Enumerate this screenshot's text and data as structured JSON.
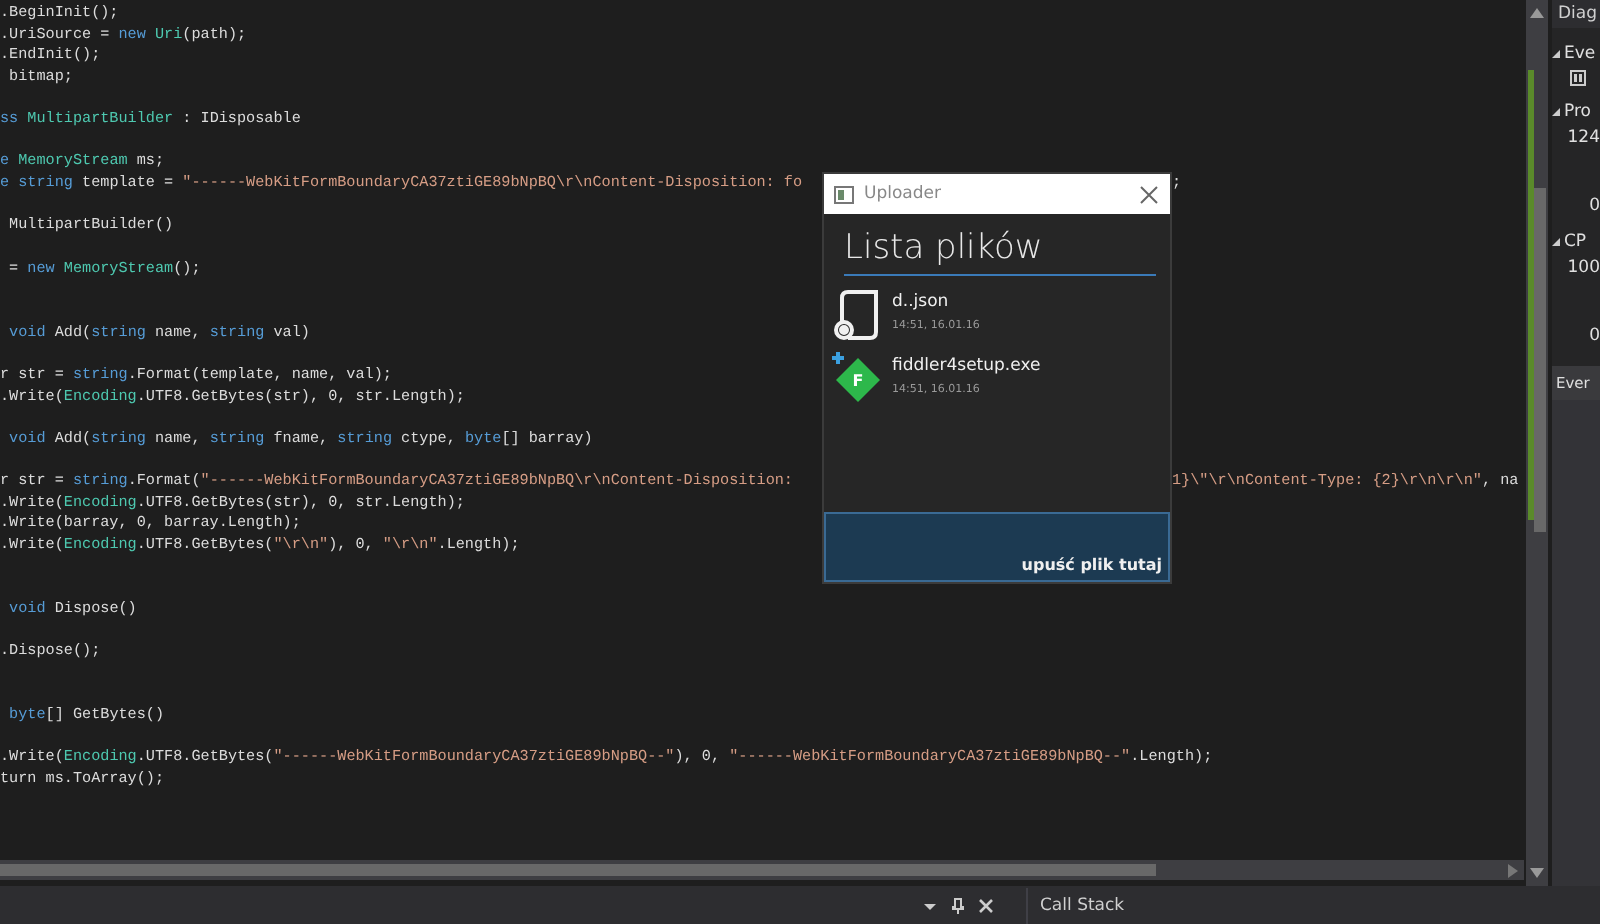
{
  "editor": {
    "lines": [
      {
        "kind": "line",
        "segments": [
          {
            "text": ".BeginInit();",
            "kind": "plain"
          }
        ]
      },
      {
        "kind": "line",
        "segments": [
          {
            "text": ".UriSource = ",
            "kind": "plain"
          },
          {
            "text": "new",
            "kind": "keyword"
          },
          {
            "text": " Uri",
            "kind": "type"
          },
          {
            "text": "(path);",
            "kind": "plain"
          }
        ]
      },
      {
        "kind": "line",
        "segments": [
          {
            "text": ".EndInit();",
            "kind": "plain"
          }
        ]
      },
      {
        "kind": "line",
        "segments": [
          {
            "text": " bitmap;",
            "kind": "plain"
          }
        ]
      },
      {
        "kind": "after_gap",
        "segments": [
          {
            "text": "ss ",
            "kind": "keyword"
          },
          {
            "text": "MultipartBuilder",
            "kind": "type"
          },
          {
            "text": " : IDisposable",
            "kind": "plain"
          }
        ]
      },
      {
        "kind": "after_gap",
        "segments": [
          {
            "text": "e ",
            "kind": "keyword"
          },
          {
            "text": "MemoryStream",
            "kind": "type"
          },
          {
            "text": " ms;",
            "kind": "plain"
          }
        ]
      },
      {
        "kind": "line",
        "segments": [
          {
            "text": "e ",
            "kind": "keyword"
          },
          {
            "text": "string",
            "kind": "keyword"
          },
          {
            "text": " template = ",
            "kind": "plain"
          },
          {
            "text": "\"------WebKitFormBoundaryCA37ztiGE89bNpBQ\\r\\nContent-Disposition: fo",
            "kind": "string"
          }
        ],
        "right_segments": [
          {
            "text": ";",
            "kind": "plain"
          }
        ]
      },
      {
        "kind": "after_gap",
        "segments": [
          {
            "text": " MultipartBuilder()",
            "kind": "plain"
          }
        ]
      },
      {
        "kind": "after_gap",
        "segments": [
          {
            "text": " = ",
            "kind": "plain"
          },
          {
            "text": "new",
            "kind": "keyword"
          },
          {
            "text": " MemoryStream",
            "kind": "type"
          },
          {
            "text": "();",
            "kind": "plain"
          }
        ]
      },
      {
        "kind": "after_double_gap",
        "segments": [
          {
            "text": " void",
            "kind": "keyword"
          },
          {
            "text": " Add(",
            "kind": "plain"
          },
          {
            "text": "string",
            "kind": "keyword"
          },
          {
            "text": " name, ",
            "kind": "plain"
          },
          {
            "text": "string",
            "kind": "keyword"
          },
          {
            "text": " val)",
            "kind": "plain"
          }
        ]
      },
      {
        "kind": "after_gap",
        "segments": [
          {
            "text": "r str = ",
            "kind": "plain"
          },
          {
            "text": "string",
            "kind": "keyword"
          },
          {
            "text": ".Format(template, name, val);",
            "kind": "plain"
          }
        ]
      },
      {
        "kind": "line",
        "segments": [
          {
            "text": ".Write(",
            "kind": "plain"
          },
          {
            "text": "Encoding",
            "kind": "type"
          },
          {
            "text": ".UTF8.GetBytes(str), 0, str.Length);",
            "kind": "plain"
          }
        ]
      },
      {
        "kind": "after_gap",
        "segments": [
          {
            "text": " void",
            "kind": "keyword"
          },
          {
            "text": " Add(",
            "kind": "plain"
          },
          {
            "text": "string",
            "kind": "keyword"
          },
          {
            "text": " name, ",
            "kind": "plain"
          },
          {
            "text": "string",
            "kind": "keyword"
          },
          {
            "text": " fname, ",
            "kind": "plain"
          },
          {
            "text": "string",
            "kind": "keyword"
          },
          {
            "text": " ctype, ",
            "kind": "plain"
          },
          {
            "text": "byte",
            "kind": "keyword"
          },
          {
            "text": "[] barray)",
            "kind": "plain"
          }
        ]
      },
      {
        "kind": "after_gap",
        "segments": [
          {
            "text": "r str = ",
            "kind": "plain"
          },
          {
            "text": "string",
            "kind": "keyword"
          },
          {
            "text": ".Format(",
            "kind": "plain"
          },
          {
            "text": "\"------WebKitFormBoundaryCA37ztiGE89bNpBQ\\r\\nContent-Disposition:",
            "kind": "string"
          }
        ],
        "right_segments": [
          {
            "text": "1}\\\"\\r\\nContent-Type: {2}\\r\\n\\r\\n\"",
            "kind": "string"
          },
          {
            "text": ", na",
            "kind": "plain"
          }
        ]
      },
      {
        "kind": "line",
        "segments": [
          {
            "text": ".Write(",
            "kind": "plain"
          },
          {
            "text": "Encoding",
            "kind": "type"
          },
          {
            "text": ".UTF8.GetBytes(str), 0, str.Length);",
            "kind": "plain"
          }
        ]
      },
      {
        "kind": "line",
        "segments": [
          {
            "text": ".Write(barray, 0, barray.Length);",
            "kind": "plain"
          }
        ]
      },
      {
        "kind": "line",
        "segments": [
          {
            "text": ".Write(",
            "kind": "plain"
          },
          {
            "text": "Encoding",
            "kind": "type"
          },
          {
            "text": ".UTF8.GetBytes(",
            "kind": "plain"
          },
          {
            "text": "\"\\r\\n\"",
            "kind": "string"
          },
          {
            "text": "), 0, ",
            "kind": "plain"
          },
          {
            "text": "\"\\r\\n\"",
            "kind": "string"
          },
          {
            "text": ".Length);",
            "kind": "plain"
          }
        ]
      },
      {
        "kind": "after_double_gap",
        "segments": [
          {
            "text": " void",
            "kind": "keyword"
          },
          {
            "text": " Dispose()",
            "kind": "plain"
          }
        ]
      },
      {
        "kind": "after_gap",
        "segments": [
          {
            "text": ".Dispose();",
            "kind": "plain"
          }
        ]
      },
      {
        "kind": "after_double_gap",
        "segments": [
          {
            "text": " byte",
            "kind": "keyword"
          },
          {
            "text": "[] GetBytes()",
            "kind": "plain"
          }
        ]
      },
      {
        "kind": "after_gap",
        "segments": [
          {
            "text": ".Write(",
            "kind": "plain"
          },
          {
            "text": "Encoding",
            "kind": "type"
          },
          {
            "text": ".UTF8.GetBytes(",
            "kind": "plain"
          },
          {
            "text": "\"------WebKitFormBoundaryCA37ztiGE89bNpBQ--\"",
            "kind": "string"
          },
          {
            "text": "), 0, ",
            "kind": "plain"
          },
          {
            "text": "\"------WebKitFormBoundaryCA37ztiGE89bNpBQ--\"",
            "kind": "string"
          },
          {
            "text": ".Length);",
            "kind": "plain"
          }
        ]
      },
      {
        "kind": "line",
        "segments": [
          {
            "text": "turn ms.ToArray();",
            "kind": "plain"
          }
        ]
      }
    ]
  },
  "uploader": {
    "title": "Uploader",
    "heading": "Lista plików",
    "files": [
      {
        "name": "d..json",
        "time": "14:51, 16.01.16",
        "kind": "document"
      },
      {
        "name": "fiddler4setup.exe",
        "time": "14:51, 16.01.16",
        "kind": "installer",
        "badge": "F"
      }
    ],
    "drop_zone": "upuść plik tutaj"
  },
  "diagnostics": {
    "title": "Diag",
    "items": [
      {
        "kind": "section",
        "text": "Eve"
      },
      {
        "kind": "toolbar"
      },
      {
        "kind": "section",
        "text": "Pro"
      },
      {
        "kind": "axis_max",
        "text": "124"
      },
      {
        "kind": "axis_min",
        "text": "0"
      },
      {
        "kind": "section",
        "text": "CP"
      },
      {
        "kind": "axis_max",
        "text": "100"
      },
      {
        "kind": "axis_min",
        "text": "0"
      },
      {
        "kind": "tab",
        "text": "Ever"
      }
    ]
  },
  "bottom_bar": {
    "tabs": [
      "Call Stack"
    ]
  }
}
